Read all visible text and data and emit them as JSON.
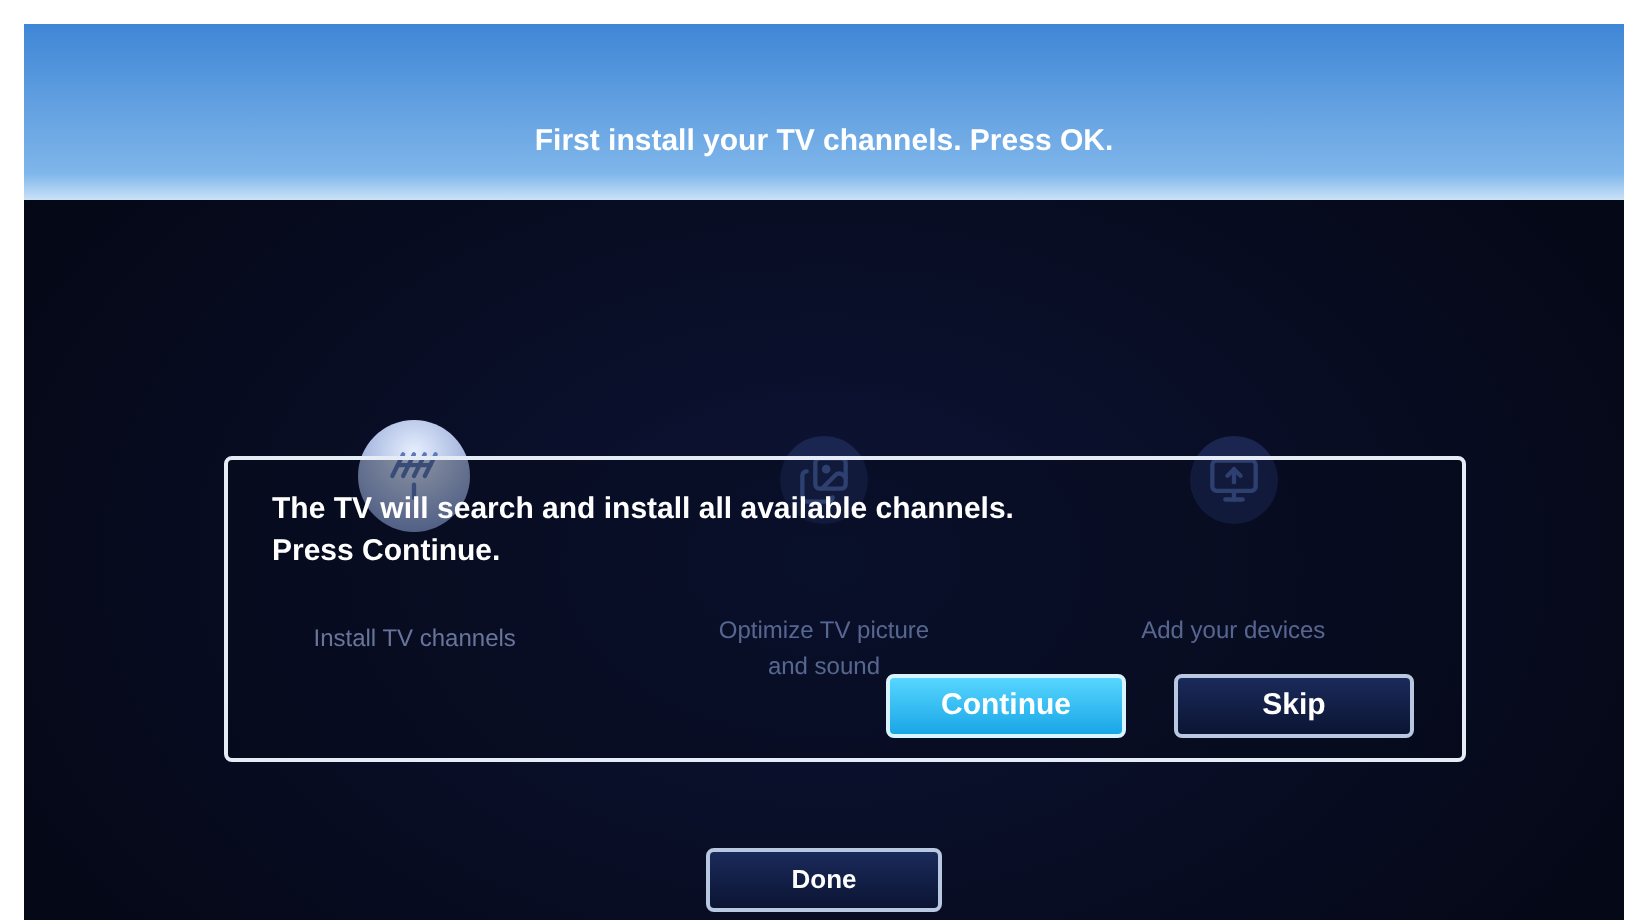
{
  "header": {
    "title": "First install your TV channels. Press OK."
  },
  "steps": [
    {
      "label": "Install TV channels",
      "selected": true
    },
    {
      "label": "Optimize TV picture and sound",
      "selected": false
    },
    {
      "label": "Add your devices",
      "selected": false
    }
  ],
  "dialog": {
    "message": "The TV will search and install all available channels. Press Continue.",
    "buttons": [
      {
        "label": "Continue",
        "selected": true
      },
      {
        "label": "Skip",
        "selected": false
      }
    ]
  },
  "done_button": {
    "label": "Done"
  }
}
